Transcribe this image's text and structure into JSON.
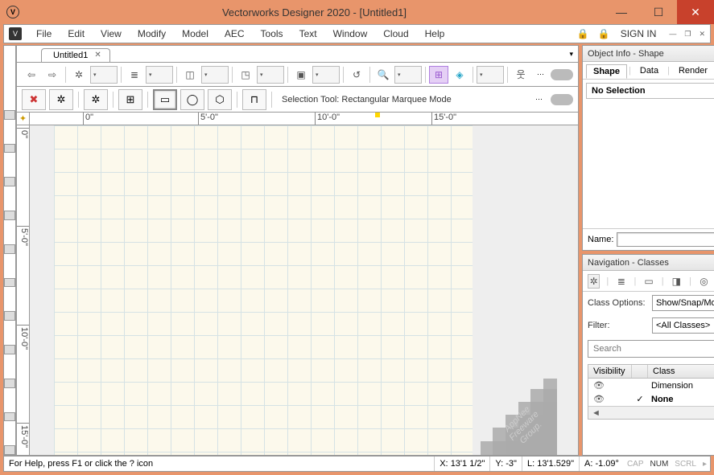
{
  "titlebar": {
    "title": "Vectorworks Designer 2020 - [Untitled1]"
  },
  "menubar": {
    "items": [
      "File",
      "Edit",
      "View",
      "Modify",
      "Model",
      "AEC",
      "Tools",
      "Text",
      "Window",
      "Cloud",
      "Help"
    ],
    "signin": "SIGN IN"
  },
  "doctab": {
    "name": "Untitled1"
  },
  "modebar": {
    "label": "Selection Tool: Rectangular Marquee Mode"
  },
  "ruler_h": [
    "0\"",
    "5'-0\"",
    "10'-0\"",
    "15'-0\""
  ],
  "ruler_v": [
    "0\"",
    "5'-0\"",
    "10'-0\"",
    "15'-0\""
  ],
  "watermark": {
    "line1": "AppNee",
    "line2": "Freeware",
    "line3": "Group."
  },
  "object_info": {
    "title": "Object Info - Shape",
    "tabs": [
      "Shape",
      "Data",
      "Render"
    ],
    "active_tab": 0,
    "no_selection": "No Selection",
    "name_label": "Name:"
  },
  "navigation": {
    "title": "Navigation - Classes",
    "class_options_label": "Class Options:",
    "class_options_value": "Show/Snap/Modify Others",
    "filter_label": "Filter:",
    "filter_value": "<All Classes>",
    "search_placeholder": "Search",
    "columns": {
      "visibility": "Visibility",
      "class": "Class"
    },
    "rows": [
      {
        "checked": false,
        "name": "Dimension",
        "bold": false
      },
      {
        "checked": true,
        "name": "None",
        "bold": true
      }
    ]
  },
  "statusbar": {
    "help": "For Help, press F1 or click the ? icon",
    "x_label": "X:",
    "x_val": "13'1 1/2\"",
    "y_label": "Y:",
    "y_val": "-3\"",
    "l_label": "L:",
    "l_val": "13'1.529\"",
    "a_label": "A:",
    "a_val": "-1.09°",
    "cap": "CAP",
    "num": "NUM",
    "scrl": "SCRL"
  }
}
